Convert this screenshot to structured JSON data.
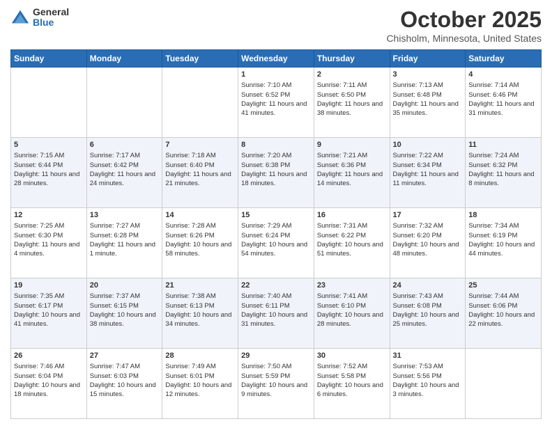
{
  "header": {
    "logo_general": "General",
    "logo_blue": "Blue",
    "month_title": "October 2025",
    "location": "Chisholm, Minnesota, United States"
  },
  "days_of_week": [
    "Sunday",
    "Monday",
    "Tuesday",
    "Wednesday",
    "Thursday",
    "Friday",
    "Saturday"
  ],
  "weeks": [
    [
      {
        "day": "",
        "info": ""
      },
      {
        "day": "",
        "info": ""
      },
      {
        "day": "",
        "info": ""
      },
      {
        "day": "1",
        "info": "Sunrise: 7:10 AM\nSunset: 6:52 PM\nDaylight: 11 hours and 41 minutes."
      },
      {
        "day": "2",
        "info": "Sunrise: 7:11 AM\nSunset: 6:50 PM\nDaylight: 11 hours and 38 minutes."
      },
      {
        "day": "3",
        "info": "Sunrise: 7:13 AM\nSunset: 6:48 PM\nDaylight: 11 hours and 35 minutes."
      },
      {
        "day": "4",
        "info": "Sunrise: 7:14 AM\nSunset: 6:46 PM\nDaylight: 11 hours and 31 minutes."
      }
    ],
    [
      {
        "day": "5",
        "info": "Sunrise: 7:15 AM\nSunset: 6:44 PM\nDaylight: 11 hours and 28 minutes."
      },
      {
        "day": "6",
        "info": "Sunrise: 7:17 AM\nSunset: 6:42 PM\nDaylight: 11 hours and 24 minutes."
      },
      {
        "day": "7",
        "info": "Sunrise: 7:18 AM\nSunset: 6:40 PM\nDaylight: 11 hours and 21 minutes."
      },
      {
        "day": "8",
        "info": "Sunrise: 7:20 AM\nSunset: 6:38 PM\nDaylight: 11 hours and 18 minutes."
      },
      {
        "day": "9",
        "info": "Sunrise: 7:21 AM\nSunset: 6:36 PM\nDaylight: 11 hours and 14 minutes."
      },
      {
        "day": "10",
        "info": "Sunrise: 7:22 AM\nSunset: 6:34 PM\nDaylight: 11 hours and 11 minutes."
      },
      {
        "day": "11",
        "info": "Sunrise: 7:24 AM\nSunset: 6:32 PM\nDaylight: 11 hours and 8 minutes."
      }
    ],
    [
      {
        "day": "12",
        "info": "Sunrise: 7:25 AM\nSunset: 6:30 PM\nDaylight: 11 hours and 4 minutes."
      },
      {
        "day": "13",
        "info": "Sunrise: 7:27 AM\nSunset: 6:28 PM\nDaylight: 11 hours and 1 minute."
      },
      {
        "day": "14",
        "info": "Sunrise: 7:28 AM\nSunset: 6:26 PM\nDaylight: 10 hours and 58 minutes."
      },
      {
        "day": "15",
        "info": "Sunrise: 7:29 AM\nSunset: 6:24 PM\nDaylight: 10 hours and 54 minutes."
      },
      {
        "day": "16",
        "info": "Sunrise: 7:31 AM\nSunset: 6:22 PM\nDaylight: 10 hours and 51 minutes."
      },
      {
        "day": "17",
        "info": "Sunrise: 7:32 AM\nSunset: 6:20 PM\nDaylight: 10 hours and 48 minutes."
      },
      {
        "day": "18",
        "info": "Sunrise: 7:34 AM\nSunset: 6:19 PM\nDaylight: 10 hours and 44 minutes."
      }
    ],
    [
      {
        "day": "19",
        "info": "Sunrise: 7:35 AM\nSunset: 6:17 PM\nDaylight: 10 hours and 41 minutes."
      },
      {
        "day": "20",
        "info": "Sunrise: 7:37 AM\nSunset: 6:15 PM\nDaylight: 10 hours and 38 minutes."
      },
      {
        "day": "21",
        "info": "Sunrise: 7:38 AM\nSunset: 6:13 PM\nDaylight: 10 hours and 34 minutes."
      },
      {
        "day": "22",
        "info": "Sunrise: 7:40 AM\nSunset: 6:11 PM\nDaylight: 10 hours and 31 minutes."
      },
      {
        "day": "23",
        "info": "Sunrise: 7:41 AM\nSunset: 6:10 PM\nDaylight: 10 hours and 28 minutes."
      },
      {
        "day": "24",
        "info": "Sunrise: 7:43 AM\nSunset: 6:08 PM\nDaylight: 10 hours and 25 minutes."
      },
      {
        "day": "25",
        "info": "Sunrise: 7:44 AM\nSunset: 6:06 PM\nDaylight: 10 hours and 22 minutes."
      }
    ],
    [
      {
        "day": "26",
        "info": "Sunrise: 7:46 AM\nSunset: 6:04 PM\nDaylight: 10 hours and 18 minutes."
      },
      {
        "day": "27",
        "info": "Sunrise: 7:47 AM\nSunset: 6:03 PM\nDaylight: 10 hours and 15 minutes."
      },
      {
        "day": "28",
        "info": "Sunrise: 7:49 AM\nSunset: 6:01 PM\nDaylight: 10 hours and 12 minutes."
      },
      {
        "day": "29",
        "info": "Sunrise: 7:50 AM\nSunset: 5:59 PM\nDaylight: 10 hours and 9 minutes."
      },
      {
        "day": "30",
        "info": "Sunrise: 7:52 AM\nSunset: 5:58 PM\nDaylight: 10 hours and 6 minutes."
      },
      {
        "day": "31",
        "info": "Sunrise: 7:53 AM\nSunset: 5:56 PM\nDaylight: 10 hours and 3 minutes."
      },
      {
        "day": "",
        "info": ""
      }
    ]
  ]
}
